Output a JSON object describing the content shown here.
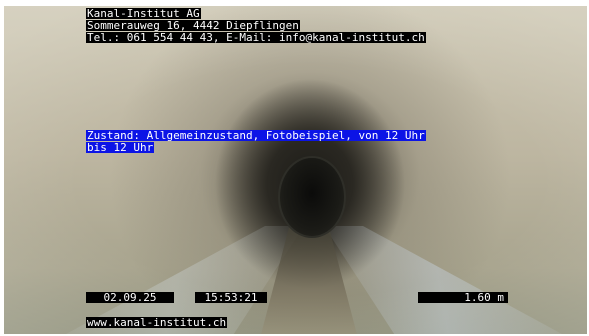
{
  "header": {
    "company": "Kanal-Institut AG",
    "address": "Sommerauweg 16, 4442 Diepflingen",
    "contact": "Tel.: 061 554 44 43, E-Mail: info@kanal-institut.ch"
  },
  "status": {
    "line1": "Zustand: Allgemeinzustand, Fotobeispiel, von 12 Uhr",
    "line2": "bis 12 Uhr"
  },
  "footer": {
    "date": " 02.09.25 ",
    "time": " 15:53:21 ",
    "distance": "1.60 m",
    "website": "www.kanal-institut.ch"
  },
  "colors": {
    "overlay_text": "#ffffff",
    "overlay_black": "#000000",
    "overlay_blue": "#0c14e6"
  }
}
